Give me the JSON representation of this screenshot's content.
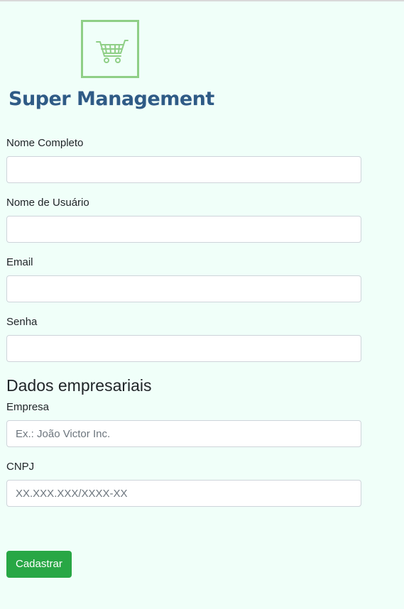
{
  "logo": {
    "title": "Super Management",
    "icon": "shopping-cart-icon",
    "accent_color": "#8fcf86",
    "text_color": "#2f5b86"
  },
  "form": {
    "fields": {
      "full_name": {
        "label": "Nome Completo",
        "value": "",
        "placeholder": ""
      },
      "username": {
        "label": "Nome de Usuário",
        "value": "",
        "placeholder": ""
      },
      "email": {
        "label": "Email",
        "value": "",
        "placeholder": ""
      },
      "password": {
        "label": "Senha",
        "value": "",
        "placeholder": ""
      }
    },
    "business_section": {
      "title": "Dados empresariais",
      "company": {
        "label": "Empresa",
        "value": "",
        "placeholder": "Ex.: João Victor Inc."
      },
      "cnpj": {
        "label": "CNPJ",
        "value": "",
        "placeholder": "XX.XXX.XXX/XXXX-XX"
      }
    },
    "submit_label": "Cadastrar",
    "submit_color": "#28a745"
  },
  "colors": {
    "background": "#f0fff9"
  }
}
